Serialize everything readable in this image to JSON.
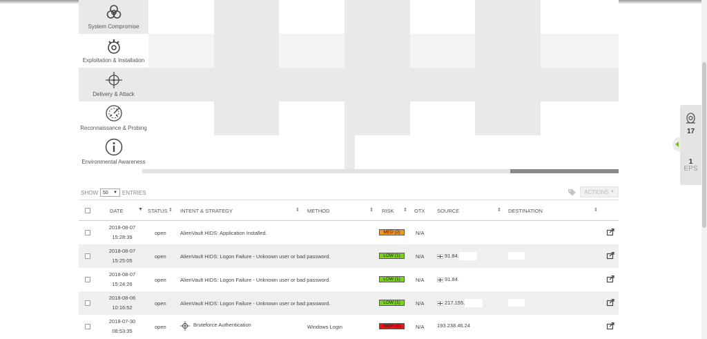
{
  "colors": {
    "grid_light": "#ffffff",
    "grid_mid": "#f4f4f4",
    "grid_dark": "#e9e9e9",
    "risk_med": "#f7941d",
    "risk_low": "#7dd21d",
    "risk_high": "#e01818",
    "accent_green": "#7dbd2b"
  },
  "kill_chain": {
    "rows": [
      {
        "label": "System Compromise",
        "icon": "biohazard-icon"
      },
      {
        "label": "Exploitation & Installation",
        "icon": "bomb-icon"
      },
      {
        "label": "Delivery & Attack",
        "icon": "crosshair-icon"
      },
      {
        "label": "Reconnaissance & Probing",
        "icon": "radar-icon"
      },
      {
        "label": "Environmental Awareness",
        "icon": "info-icon"
      }
    ]
  },
  "side_widget": {
    "alarm_count": "17",
    "eps_value": "1",
    "eps_label": "EPS",
    "icon": "alarm-icon"
  },
  "controls": {
    "show_label": "SHOW",
    "entries_value": "50",
    "entries_label": "ENTRIES",
    "actions_label": "ACTIONS"
  },
  "table": {
    "columns": {
      "date": "DATE",
      "status": "STATUS",
      "intent": "INTENT & STRATEGY",
      "method": "METHOD",
      "risk": "RISK",
      "otx": "OTX",
      "source": "SOURCE",
      "destination": "DESTINATION"
    },
    "rows": [
      {
        "date": "2018-08-07",
        "time": "15:28:39",
        "status": "open",
        "intent": "AlienVault HIDS: Application Installed.",
        "method": "",
        "risk": "MED (2)",
        "risk_level": "med",
        "otx": "N/A",
        "source": "",
        "source_flag": false,
        "intent_icon": false
      },
      {
        "date": "2018-08-07",
        "time": "15:25:05",
        "status": "open",
        "intent": "AlienVault HIDS: Logon Failure - Unknown user or bad password.",
        "method": "",
        "risk": "LOW (1)",
        "risk_level": "low",
        "otx": "N/A",
        "source": "91.84.",
        "source_flag": true,
        "intent_icon": false
      },
      {
        "date": "2018-08-07",
        "time": "15:24:26",
        "status": "open",
        "intent": "AlienVault HIDS: Logon Failure - Unknown user or bad password.",
        "method": "",
        "risk": "LOW (1)",
        "risk_level": "low",
        "otx": "N/A",
        "source": "91.84.",
        "source_flag": true,
        "intent_icon": false
      },
      {
        "date": "2018-08-06",
        "time": "10:16:52",
        "status": "open",
        "intent": "AlienVault HIDS: Logon Failure - Unknown user or bad password.",
        "method": "",
        "risk": "LOW (1)",
        "risk_level": "low",
        "otx": "N/A",
        "source": "217.155.",
        "source_flag": true,
        "intent_icon": false
      },
      {
        "date": "2018-07-30",
        "time": "08:53:35",
        "status": "open",
        "intent": "Bruteforce Authentication",
        "method": "Windows Login",
        "risk": "HIGH (8)",
        "risk_level": "high",
        "otx": "N/A",
        "source": "193.238.46.24",
        "source_flag": false,
        "intent_icon": true
      }
    ]
  }
}
